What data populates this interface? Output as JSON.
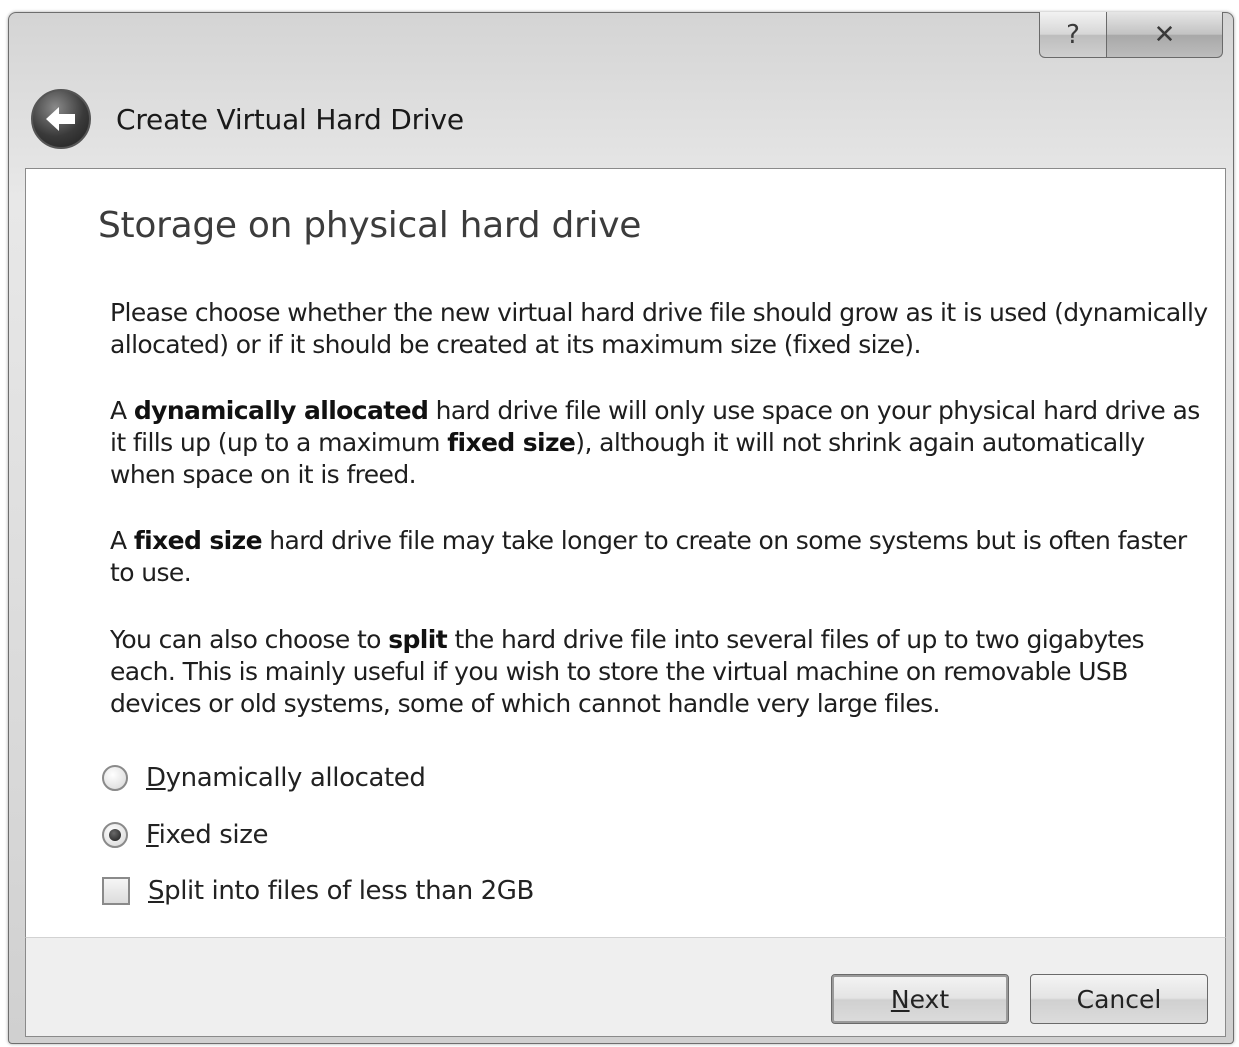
{
  "window": {
    "title": "Create Virtual Hard Drive",
    "help_label": "?",
    "close_label": "✕"
  },
  "page": {
    "heading": "Storage on physical hard drive",
    "p1": "Please choose whether the new virtual hard drive file should grow as it is used (dynamically allocated) or if it should be created at its maximum size (fixed size).",
    "p2": {
      "a": "A ",
      "b1": "dynamically allocated",
      "c": " hard drive file will only use space on your physical hard drive as it fills up (up to a maximum ",
      "b2": "fixed size",
      "d": "), although it will not shrink again automatically when space on it is freed."
    },
    "p3": {
      "a": "A ",
      "b1": "fixed size",
      "c": " hard drive file may take longer to create on some systems but is often faster to use."
    },
    "p4": {
      "a": "You can also choose to ",
      "b1": "split",
      "c": " the hard drive file into several files of up to two gigabytes each. This is mainly useful if you wish to store the virtual machine on removable USB devices or old systems, some of which cannot handle very large files."
    }
  },
  "options": {
    "dynamic": {
      "mnemonic": "D",
      "rest": "ynamically allocated",
      "checked": false
    },
    "fixed": {
      "mnemonic": "F",
      "rest": "ixed size",
      "checked": true
    },
    "split": {
      "mnemonic": "S",
      "rest": "plit into files of less than 2GB",
      "checked": false
    }
  },
  "buttons": {
    "next": {
      "mnemonic": "N",
      "rest": "ext"
    },
    "cancel": "Cancel"
  }
}
